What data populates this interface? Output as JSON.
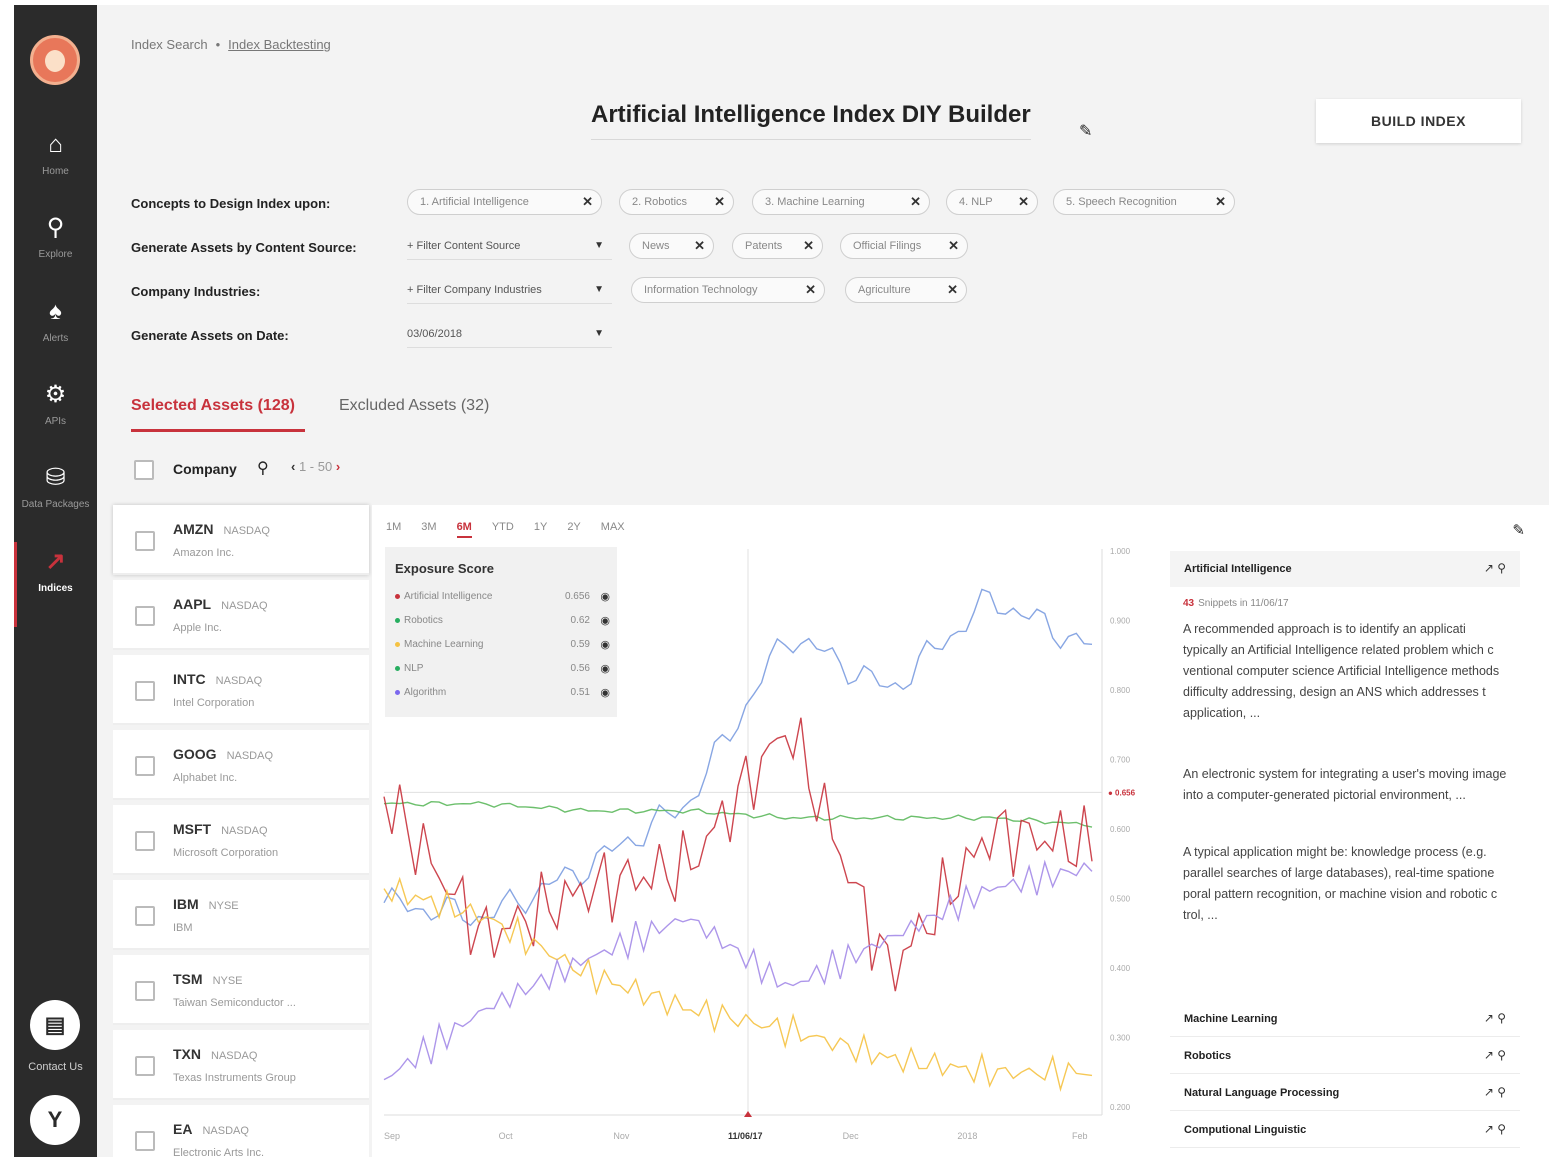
{
  "sidebar": {
    "items": [
      {
        "icon": "home-icon",
        "glyph": "⌂",
        "label": "Home"
      },
      {
        "icon": "search-icon",
        "glyph": "⚲",
        "label": "Explore"
      },
      {
        "icon": "bell-icon",
        "glyph": "♠",
        "label": "Alerts"
      },
      {
        "icon": "gear-icon",
        "glyph": "⚙",
        "label": "APIs"
      },
      {
        "icon": "database-icon",
        "glyph": "⛁",
        "label": "Data Packages"
      },
      {
        "icon": "indices-chart-icon",
        "glyph": "↗",
        "label": "Indices"
      }
    ],
    "contact_label": "Contact Us",
    "accent": "#c8323c"
  },
  "breadcrumb": {
    "root": "Index Search",
    "separator": "•",
    "current": "Index Backtesting"
  },
  "title": "Artificial Intelligence Index DIY Builder",
  "build_button": "BUILD INDEX",
  "filters": {
    "concepts_label": "Concepts to Design Index upon:",
    "concepts": [
      "1. Artificial Intelligence",
      "2. Robotics",
      "3. Machine Learning",
      "4. NLP",
      "5. Speech Recognition"
    ],
    "content_source_label": "Generate Assets by Content Source:",
    "content_source_placeholder": "+ Filter Content Source",
    "content_sources": [
      "News",
      "Patents",
      "Official Filings"
    ],
    "industries_label": "Company Industries:",
    "industries_placeholder": "+ Filter Company Industries",
    "industries": [
      "Information Technology",
      "Agriculture"
    ],
    "date_label": "Generate Assets on Date:",
    "date_value": "03/06/2018"
  },
  "tabs": {
    "selected": "Selected Assets (128)",
    "excluded": "Excluded Assets (32)"
  },
  "list_header": {
    "company": "Company",
    "pager": "1 - 50"
  },
  "assets": [
    {
      "ticker": "AMZN",
      "exchange": "NASDAQ",
      "name": "Amazon Inc."
    },
    {
      "ticker": "AAPL",
      "exchange": "NASDAQ",
      "name": "Apple Inc."
    },
    {
      "ticker": "INTC",
      "exchange": "NASDAQ",
      "name": "Intel Corporation"
    },
    {
      "ticker": "GOOG",
      "exchange": "NASDAQ",
      "name": "Alphabet Inc."
    },
    {
      "ticker": "MSFT",
      "exchange": "NASDAQ",
      "name": "Microsoft Corporation"
    },
    {
      "ticker": "IBM",
      "exchange": "NYSE",
      "name": "IBM"
    },
    {
      "ticker": "TSM",
      "exchange": "NYSE",
      "name": "Taiwan Semiconductor ..."
    },
    {
      "ticker": "TXN",
      "exchange": "NASDAQ",
      "name": "Texas Instruments Group"
    },
    {
      "ticker": "EA",
      "exchange": "NASDAQ",
      "name": "Electronic Arts Inc."
    }
  ],
  "chart": {
    "ranges": [
      "1M",
      "3M",
      "6M",
      "YTD",
      "1Y",
      "2Y",
      "MAX"
    ],
    "active_range": "6M",
    "exposure_title": "Exposure Score",
    "exposure": [
      {
        "name": "Artificial Intelligence",
        "value": "0.656",
        "color": "#c8323c"
      },
      {
        "name": "Robotics",
        "value": "0.62",
        "color": "#27ae60"
      },
      {
        "name": "Machine Learning",
        "value": "0.59",
        "color": "#f5c242"
      },
      {
        "name": "NLP",
        "value": "0.56",
        "color": "#27ae60"
      },
      {
        "name": "Algorithm",
        "value": "0.51",
        "color": "#7b68ee"
      }
    ],
    "x_ticks": [
      "Sep",
      "Oct",
      "Nov",
      "11/06/17",
      "Dec",
      "2018",
      "Feb"
    ],
    "y_ticks": [
      "1.000",
      "0.900",
      "0.800",
      "0.700",
      "0.600",
      "0.500",
      "0.400",
      "0.300",
      "0.200"
    ],
    "marker_value": "0.656",
    "marker_date": "11/06/17"
  },
  "chart_data": {
    "type": "line",
    "x": [
      "Sep",
      "Oct",
      "Nov",
      "11/06/17",
      "Dec",
      "2018",
      "Feb"
    ],
    "ylim": [
      0.2,
      1.0
    ],
    "series": [
      {
        "color": "#7b9ce0",
        "values": [
          0.5,
          0.48,
          0.55,
          0.64,
          0.88,
          0.8,
          0.93,
          0.86
        ]
      },
      {
        "color": "#5cb85c",
        "values": [
          0.64,
          0.64,
          0.63,
          0.63,
          0.62,
          0.62,
          0.62,
          0.61
        ]
      },
      {
        "color": "#c8323c",
        "values": [
          0.65,
          0.45,
          0.52,
          0.55,
          0.75,
          0.4,
          0.6,
          0.58
        ]
      },
      {
        "color": "#f5c242",
        "values": [
          0.52,
          0.48,
          0.4,
          0.35,
          0.32,
          0.28,
          0.26,
          0.26
        ]
      },
      {
        "color": "#a48be8",
        "values": [
          0.25,
          0.35,
          0.42,
          0.48,
          0.38,
          0.45,
          0.52,
          0.55
        ]
      }
    ]
  },
  "snippets": {
    "concept": "Artificial Intelligence",
    "count": "43",
    "count_suffix": "Snippets in 11/06/17",
    "texts": [
      "A recommended approach is to identify an applicati typically an Artificial Intelligence related problem which c ventional computer science Artificial Intelligence methods difficulty addressing, design an ANS which addresses t application, ...",
      "An electronic system for integrating a user's moving image into a computer-generated pictorial environment, ...",
      "A typical application might be: knowledge process (e.g. parallel searches of large databases), real-time spatione poral pattern recognition, or machine vision and robotic c trol, ..."
    ],
    "other_concepts": [
      "Machine Learning",
      "Robotics",
      "Natural Language Processing",
      "Computional Linguistic"
    ]
  }
}
